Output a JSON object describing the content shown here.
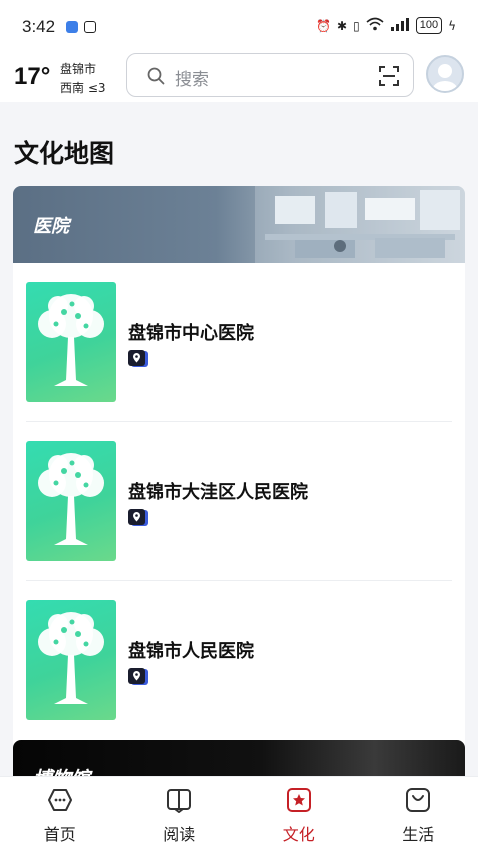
{
  "status_bar": {
    "time": "3:42",
    "battery": "100"
  },
  "header": {
    "temperature": "17°",
    "city": "盘锦市",
    "wind": "西南 ≤3",
    "search_placeholder": "搜索"
  },
  "page_title": "文化地图",
  "sections": [
    {
      "title": "医院",
      "items": [
        {
          "name": "盘锦市中心医院"
        },
        {
          "name": "盘锦市大洼区人民医院"
        },
        {
          "name": "盘锦市人民医院"
        }
      ]
    },
    {
      "title": "博物馆"
    }
  ],
  "bottom_nav": [
    {
      "label": "首页",
      "icon": "home-icon"
    },
    {
      "label": "阅读",
      "icon": "book-icon"
    },
    {
      "label": "文化",
      "icon": "culture-star-icon",
      "active": true
    },
    {
      "label": "生活",
      "icon": "life-bag-icon"
    }
  ],
  "colors": {
    "accent": "#c52026",
    "thumb_gradient_start": "#34dcb1",
    "thumb_gradient_end": "#6bd98b"
  }
}
